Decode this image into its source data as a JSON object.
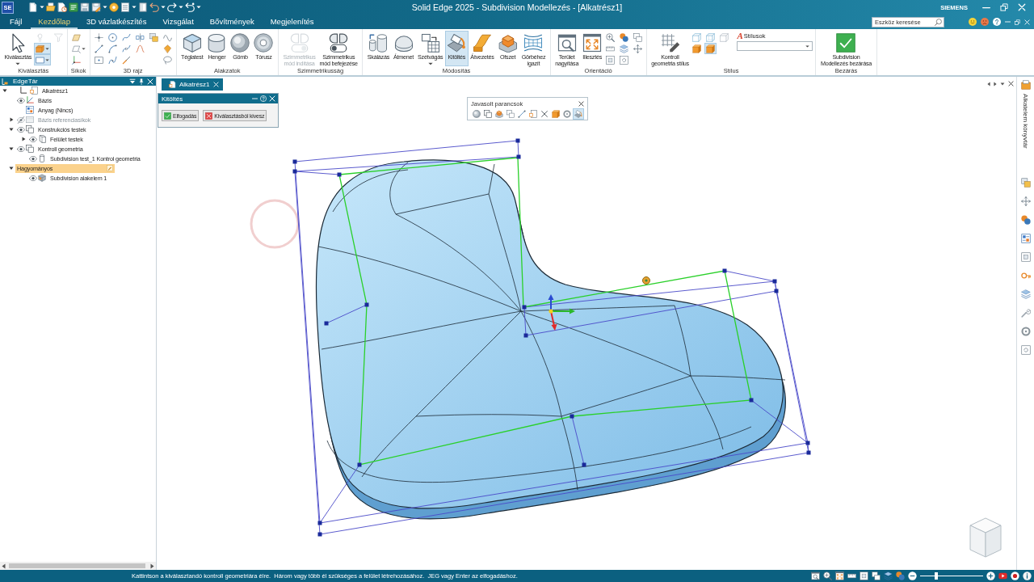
{
  "title_bar": {
    "logo": "SE",
    "title": "Solid Edge 2025 - Subdivision Modellezés - [Alkatrész1]",
    "brand": "SIEMENS"
  },
  "menu": {
    "tabs": [
      {
        "label": "Fájl",
        "selected": false
      },
      {
        "label": "Kezdőlap",
        "selected": true
      },
      {
        "label": "3D vázlatkészítés",
        "selected": false
      },
      {
        "label": "Vizsgálat",
        "selected": false
      },
      {
        "label": "Bővítmények",
        "selected": false
      },
      {
        "label": "Megjelenítés",
        "selected": false
      }
    ],
    "search": {
      "placeholder": "Eszköz keresése"
    }
  },
  "ribbon": [
    {
      "label": "Kiválasztás",
      "tools": [
        {
          "label": "Kiválasztás",
          "selected": false,
          "disabled": false,
          "dropdown": true
        }
      ],
      "tool_columns": [
        [
          {
            "selected": false,
            "disabled": true,
            "dropdown": false
          },
          {
            "selected": true,
            "disabled": false,
            "dropdown": true
          },
          {
            "selected": true,
            "disabled": false,
            "dropdown": true
          }
        ],
        [
          {
            "selected": false,
            "disabled": true,
            "dropdown": false
          }
        ]
      ]
    },
    {
      "label": "Síkok",
      "tool_columns": [
        [
          {
            "selected": false,
            "disabled": false,
            "dropdown": false
          },
          {
            "selected": false,
            "disabled": false,
            "dropdown": true
          },
          {
            "selected": false,
            "disabled": false,
            "dropdown": false
          }
        ]
      ]
    },
    {
      "label": "3D rajz",
      "tool_columns": [
        [
          {
            "selected": false,
            "disabled": false,
            "dropdown": false
          },
          {
            "selected": false,
            "disabled": false,
            "dropdown": false
          },
          {
            "selected": false,
            "disabled": false,
            "dropdown": false
          }
        ],
        [
          {
            "selected": false,
            "disabled": false,
            "dropdown": false
          },
          {
            "selected": false,
            "disabled": false,
            "dropdown": false
          },
          {
            "selected": false,
            "disabled": false,
            "dropdown": false
          }
        ],
        [
          {
            "selected": false,
            "disabled": false,
            "dropdown": false
          },
          {
            "selected": false,
            "disabled": false,
            "dropdown": false
          },
          {
            "selected": false,
            "disabled": false,
            "dropdown": false
          }
        ],
        [
          {
            "selected": false,
            "disabled": false,
            "dropdown": false
          },
          {
            "selected": false,
            "disabled": false,
            "dropdown": false
          }
        ],
        [
          {
            "selected": false,
            "disabled": false,
            "dropdown": false
          }
        ],
        [
          {
            "selected": false,
            "disabled": false,
            "dropdown": false
          },
          {
            "selected": false,
            "disabled": false,
            "dropdown": false
          },
          {
            "selected": false,
            "disabled": false,
            "dropdown": false
          }
        ]
      ]
    },
    {
      "label": "Alakzatok",
      "tools": [
        {
          "label": "Téglatest",
          "selected": false,
          "disabled": false,
          "dropdown": false
        },
        {
          "label": "Henger",
          "selected": false,
          "disabled": false,
          "dropdown": false
        },
        {
          "label": "Gömb",
          "selected": false,
          "disabled": false,
          "dropdown": false
        },
        {
          "label": "Tórusz",
          "selected": false,
          "disabled": false,
          "dropdown": false
        }
      ]
    },
    {
      "label": "Szimmetrikusság",
      "tools": [
        {
          "label": "Szimmetrikus\nmód indítása",
          "selected": false,
          "disabled": true,
          "dropdown": false
        },
        {
          "label": "Szimmetrikus\nmód befejezése",
          "selected": false,
          "disabled": false,
          "dropdown": false
        }
      ]
    },
    {
      "label": "Módosítás",
      "tools": [
        {
          "label": "Skálázás",
          "selected": false,
          "disabled": false,
          "dropdown": false
        },
        {
          "label": "Átmenet",
          "selected": false,
          "disabled": false,
          "dropdown": false
        },
        {
          "label": "Szétvágás",
          "selected": false,
          "disabled": false,
          "dropdown": true
        },
        {
          "label": "Kitöltés",
          "selected": true,
          "disabled": false,
          "dropdown": false
        },
        {
          "label": "Átvezetés",
          "selected": false,
          "disabled": false,
          "dropdown": false
        },
        {
          "label": "Ofszet",
          "selected": false,
          "disabled": false,
          "dropdown": false
        },
        {
          "label": "Görbéhez\nigazít",
          "selected": false,
          "disabled": false,
          "dropdown": false
        }
      ]
    },
    {
      "label": "Orientáció",
      "tools": [
        {
          "label": "Terület\nnagyítása",
          "selected": false,
          "disabled": false,
          "dropdown": false
        },
        {
          "label": "Illesztés",
          "selected": false,
          "disabled": false,
          "dropdown": false
        }
      ],
      "tool_columns": [
        [
          {
            "selected": false,
            "disabled": false,
            "dropdown": false
          },
          {
            "selected": false,
            "disabled": false,
            "dropdown": false
          },
          {
            "selected": false,
            "disabled": false,
            "dropdown": false
          }
        ],
        [
          {
            "selected": false,
            "disabled": false,
            "dropdown": false
          },
          {
            "selected": false,
            "disabled": false,
            "dropdown": false
          },
          {
            "selected": false,
            "disabled": false,
            "dropdown": false
          }
        ],
        [
          {
            "selected": false,
            "disabled": false,
            "dropdown": false
          },
          {
            "selected": false,
            "disabled": false,
            "dropdown": false
          }
        ]
      ]
    },
    {
      "label": "Stílus",
      "tools": [
        {
          "label": "Kontroll\ngeometria stílus",
          "selected": false,
          "disabled": false,
          "dropdown": false
        }
      ],
      "tool_columns": [
        [
          {
            "selected": false,
            "disabled": false,
            "dropdown": false
          },
          {
            "selected": false,
            "disabled": false,
            "dropdown": false
          }
        ],
        [
          {
            "selected": false,
            "disabled": false,
            "dropdown": false
          },
          {
            "selected": true,
            "disabled": false,
            "dropdown": false
          }
        ],
        [
          {
            "selected": false,
            "disabled": false,
            "dropdown": false
          }
        ]
      ],
      "style_picker": {
        "glyph": "A",
        "label": "Stílusok"
      }
    },
    {
      "label": "Bezárás",
      "tools": [
        {
          "label": "Subdivision\nModellezés bezárása",
          "selected": false,
          "disabled": false,
          "dropdown": false
        }
      ]
    }
  ],
  "edgebar": {
    "title": "EdgeTár",
    "tree": [
      {
        "label": "Alkatrész1",
        "kind": "part",
        "expanded": true,
        "selected": false,
        "children": [
          {
            "label": "Bázis",
            "kind": "axes",
            "visible": true,
            "selected": false
          },
          {
            "label": "Anyag (Nincs)",
            "kind": "material",
            "selected": false
          },
          {
            "label": "Bázis referenciasíkok",
            "kind": "planes",
            "expanded": false,
            "visible": false,
            "selected": false
          },
          {
            "label": "Konstrukciós testek",
            "kind": "bodies",
            "expanded": true,
            "visible": true,
            "selected": false,
            "children": [
              {
                "label": "Felület testek",
                "kind": "body",
                "expanded": false,
                "visible": true,
                "selected": false
              }
            ]
          },
          {
            "label": "Kontroll geometria",
            "kind": "bodies",
            "expanded": true,
            "visible": true,
            "selected": false,
            "children": [
              {
                "label": "Subdivision test_1 Kontrol geometria",
                "kind": "cage",
                "visible": true,
                "selected": false
              }
            ]
          },
          {
            "label": "Hagyományos",
            "kind": "group",
            "expanded": true,
            "selected": true,
            "children": [
              {
                "label": "Subdivision alakelem 1",
                "kind": "feature",
                "visible": true,
                "selected": false
              }
            ]
          }
        ]
      }
    ]
  },
  "document_tabs": [
    {
      "label": "Alkatrész1",
      "selected": true
    }
  ],
  "fill_dialog": {
    "title": "Kitöltés",
    "buttons": [
      {
        "label": "Elfogadás",
        "kind": "accept"
      },
      {
        "label": "Kiválasztásból kivesz",
        "kind": "remove"
      }
    ]
  },
  "suggested_commands": {
    "title": "Javasolt parancsok",
    "tools": [
      {
        "selected": false
      },
      {
        "selected": false
      },
      {
        "selected": false
      },
      {
        "selected": false
      },
      {
        "selected": false
      },
      {
        "selected": false
      },
      {
        "selected": false
      },
      {
        "selected": false
      },
      {
        "selected": false
      },
      {
        "selected": true
      }
    ]
  },
  "library_panel": {
    "title": "Alkatelem könyvtár"
  },
  "status_bar": {
    "message": "Kattintson a kiválasztandó kontroll geometriára élre.  Három vagy több él szükséges a felület létrehozásához.  JEG vagy Enter az elfogadáshoz.",
    "zoom_slider": {
      "level": 0.25
    }
  }
}
